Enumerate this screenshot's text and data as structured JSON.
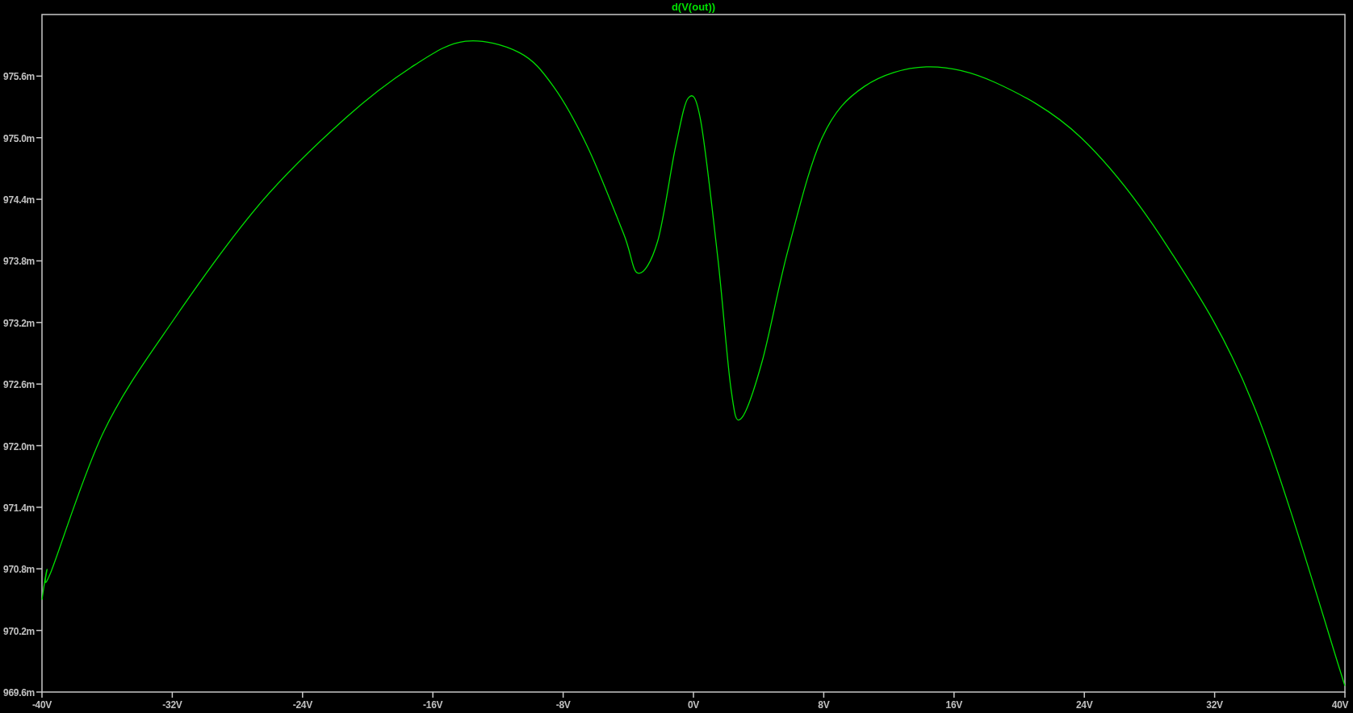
{
  "plot": {
    "chart_data": {
      "type": "line",
      "xlim": [
        -40,
        40
      ],
      "ylim": [
        969.6,
        976.2
      ],
      "xticks": [
        {
          "value": -40,
          "label": "-40V"
        },
        {
          "value": -32,
          "label": "-32V"
        },
        {
          "value": -24,
          "label": "-24V"
        },
        {
          "value": -16,
          "label": "-16V"
        },
        {
          "value": -8,
          "label": "-8V"
        },
        {
          "value": 0,
          "label": "0V"
        },
        {
          "value": 8,
          "label": "8V"
        },
        {
          "value": 16,
          "label": "16V"
        },
        {
          "value": 24,
          "label": "24V"
        },
        {
          "value": 32,
          "label": "32V"
        },
        {
          "value": 40,
          "label": "40V"
        }
      ],
      "yticks": [
        {
          "value": 969.6,
          "label": "969.6m"
        },
        {
          "value": 970.2,
          "label": "970.2m"
        },
        {
          "value": 970.8,
          "label": "970.8m"
        },
        {
          "value": 971.4,
          "label": "971.4m"
        },
        {
          "value": 972.0,
          "label": "972.0m"
        },
        {
          "value": 972.6,
          "label": "972.6m"
        },
        {
          "value": 973.2,
          "label": "973.2m"
        },
        {
          "value": 973.8,
          "label": "973.8m"
        },
        {
          "value": 974.4,
          "label": "974.4m"
        },
        {
          "value": 975.0,
          "label": "975.0m"
        },
        {
          "value": 975.6,
          "label": "975.6m"
        }
      ],
      "x": [
        -40,
        -39.7,
        -39.5,
        -36.2,
        -31.9,
        -26.6,
        -21.3,
        -17.1,
        -14.0,
        -10.7,
        -8.6,
        -6.5,
        -4.3,
        -3.4,
        -2.2,
        -1.1,
        -0.3,
        0.45,
        1.5,
        2.3,
        2.9,
        4.2,
        5.8,
        7.9,
        10.5,
        14.3,
        18.5,
        23.8,
        29.1,
        34.4,
        40
      ],
      "series": [
        {
          "name": "d(V(out))",
          "color": "#00e000",
          "values": [
            970.5,
            970.79,
            970.75,
            972.14,
            973.23,
            974.36,
            975.2,
            975.71,
            975.94,
            975.83,
            975.5,
            974.91,
            974.07,
            973.68,
            973.99,
            974.91,
            975.39,
            975.16,
            973.82,
            972.56,
            972.26,
            972.81,
            973.9,
            975.0,
            975.5,
            975.69,
            975.54,
            975.0,
            973.94,
            972.39,
            969.66
          ]
        }
      ]
    }
  }
}
